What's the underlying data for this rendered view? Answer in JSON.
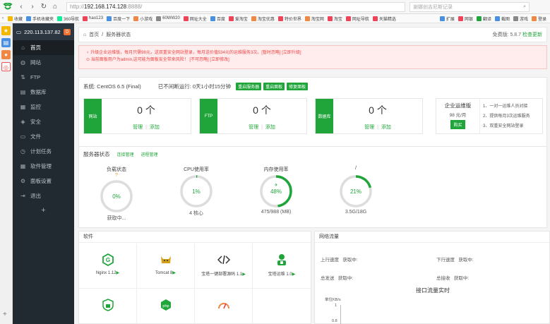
{
  "browser": {
    "url_protocol": "http://",
    "url_host": "192.168.174.128",
    "url_port_path": ":8888/",
    "search_placeholder": "谢娜创吉尼斯记录",
    "bookmarks": [
      "收藏",
      "手机收藏夹",
      "360导航",
      "hao123",
      "百度一下",
      "小游戏",
      "60WW20",
      "网址大全",
      "百度",
      "爱淘宝",
      "淘宝优惠",
      "特价世界",
      "淘宝网",
      "淘宝",
      "网址导航",
      "天猫精选"
    ],
    "toolbar_right": [
      "扩展",
      "网银",
      "翻译",
      "截图",
      "游戏",
      "登录"
    ]
  },
  "sidebar": {
    "server_ip": "220.113.137.82",
    "badge": "0",
    "items": [
      {
        "label": "首页",
        "icon": "home-icon",
        "active": true
      },
      {
        "label": "网站",
        "icon": "globe-icon"
      },
      {
        "label": "FTP",
        "icon": "ftp-icon"
      },
      {
        "label": "数据库",
        "icon": "database-icon"
      },
      {
        "label": "监控",
        "icon": "monitor-icon"
      },
      {
        "label": "安全",
        "icon": "shield-icon"
      },
      {
        "label": "文件",
        "icon": "folder-icon"
      },
      {
        "label": "计划任务",
        "icon": "clock-icon"
      },
      {
        "label": "软件管理",
        "icon": "grid-icon"
      },
      {
        "label": "面板设置",
        "icon": "gear-icon"
      },
      {
        "label": "退出",
        "icon": "exit-icon"
      }
    ],
    "add": "+"
  },
  "breadcrumb": {
    "home": "首页",
    "sep": "/",
    "current": "服务器状态",
    "version_label": "免费版: 5.8.7",
    "update": "检查更新"
  },
  "alert": {
    "line1": "升级企业运维版，每月只需98元，送双重安全网站登录，每月送价值534元的运维服务3次。",
    "line1_link1": "[暂时忽略]",
    "line1_link2": "[立即升级]",
    "line2": "当前面板用户为admin,这可能为面板安全带来风险！",
    "line2_link1": "[不可忽略]",
    "line2_link2": "[立即修改]"
  },
  "system": {
    "os": "系统: CentOS 6.5 (Final)",
    "uptime": "已不间断运行: 0天1小时15分钟",
    "buttons": [
      "重启服务器",
      "重启面板",
      "修复面板"
    ]
  },
  "cards": [
    {
      "label": "网站",
      "count": "0 个",
      "manage": "管理",
      "add": "添加"
    },
    {
      "label": "FTP",
      "count": "0 个",
      "manage": "管理",
      "add": "添加"
    },
    {
      "label": "数据库",
      "count": "0 个",
      "manage": "管理",
      "add": "添加"
    }
  ],
  "enterprise": {
    "title": "企业运维版",
    "price": "98 元/月",
    "buy": "购买",
    "features": [
      "1、一对一运维人员对接",
      "2、提供每月3次运维服务",
      "3、双重安全网站登录"
    ]
  },
  "status": {
    "title": "服务器状态",
    "link1": "连接管理",
    "link2": "进程管理",
    "gauges": [
      {
        "title": "负载状态",
        "value": "0%",
        "sub": "获取中...",
        "fraction": 0
      },
      {
        "title": "CPU使用率",
        "value": "1%",
        "sub": "4 核心",
        "fraction": 0.01
      },
      {
        "title": "内存使用率",
        "value": "48%",
        "sub": "475/988 (MB)",
        "fraction": 0.48
      },
      {
        "title": "/",
        "value": "21%",
        "sub": "3.5G/18G",
        "fraction": 0.21
      }
    ]
  },
  "software": {
    "title": "软件",
    "items": [
      {
        "name": "Nginx 1.12",
        "icon": "nginx-icon"
      },
      {
        "name": "Tomcat 8",
        "icon": "tomcat-icon"
      },
      {
        "name": "宝塔一键部署源码 1.1",
        "icon": "code-icon"
      },
      {
        "name": "宝塔运维 1.0",
        "icon": "ops-icon"
      },
      {
        "name": "",
        "icon": "lock-icon"
      },
      {
        "name": "",
        "icon": "php-icon"
      },
      {
        "name": "",
        "icon": "speed-icon"
      }
    ],
    "arrow": "▶"
  },
  "network": {
    "title": "网络流量",
    "up_label": "上行速度",
    "up_value": "获取中",
    "down_label": "下行速度",
    "down_value": "获取中",
    "sent_label": "总发送",
    "sent_value": "获取中",
    "recv_label": "总接收",
    "recv_value": "获取中",
    "chart_title": "接口流量实时",
    "unit": "单位KB/s",
    "tick1": "1",
    "tick08": "0.8"
  },
  "colors": {
    "accent": "#20a53a",
    "sidebar": "#222a31",
    "alert_bg": "#ffecec",
    "alert_text": "#e44444",
    "gauge_track": "#dddddd"
  }
}
